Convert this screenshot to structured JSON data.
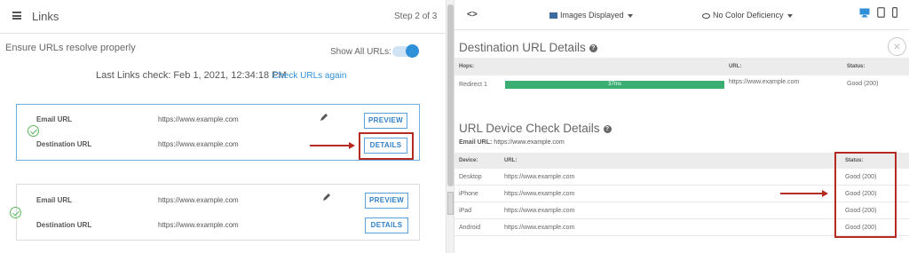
{
  "left": {
    "header": {
      "title": "Links",
      "step": "Step 2 of 3"
    },
    "ensure_label": "Ensure URLs resolve properly",
    "show_all_label": "Show All URLs:",
    "show_all_on": true,
    "last_check": "Last Links check: Feb 1, 2021, 12:34:18 PM",
    "check_again": "Check URLs again",
    "cards": [
      {
        "email_label": "Email URL",
        "email_url": "https://www.example.com",
        "dest_label": "Destination URL",
        "dest_url": "https://www.example.com",
        "preview": "PREVIEW",
        "details": "DETAILS"
      },
      {
        "email_label": "Email URL",
        "email_url": "https://www.example.com",
        "dest_label": "Destination URL",
        "dest_url": "https://www.example.com",
        "preview": "PREVIEW",
        "details": "DETAILS"
      }
    ]
  },
  "right": {
    "header": {
      "code_icon": "<>",
      "images": "Images Displayed",
      "color": "No Color Deficiency"
    },
    "dest": {
      "title": "Destination URL Details",
      "cols": [
        "Hops:",
        "URL:",
        "Status:"
      ],
      "rows": [
        {
          "hop": "Redirect 1",
          "bar_label": "37ms",
          "bar_fraction": 1.0,
          "url": "https://www.example.com",
          "status": "Good (200)"
        }
      ]
    },
    "device": {
      "title": "URL Device Check Details",
      "email_url_label": "Email URL:",
      "email_url": "https://www.example.com",
      "cols": [
        "Device:",
        "URL:",
        "Status:"
      ],
      "rows": [
        {
          "device": "Desktop",
          "url": "https://www.example.com",
          "status": "Good (200)"
        },
        {
          "device": "iPhone",
          "url": "https://www.example.com",
          "status": "Good (200)"
        },
        {
          "device": "iPad",
          "url": "https://www.example.com",
          "status": "Good (200)"
        },
        {
          "device": "Android",
          "url": "https://www.example.com",
          "status": "Good (200)"
        }
      ]
    }
  },
  "colors": {
    "accent": "#2f8fd8",
    "highlight": "#b52a22",
    "success": "#3aae73"
  }
}
